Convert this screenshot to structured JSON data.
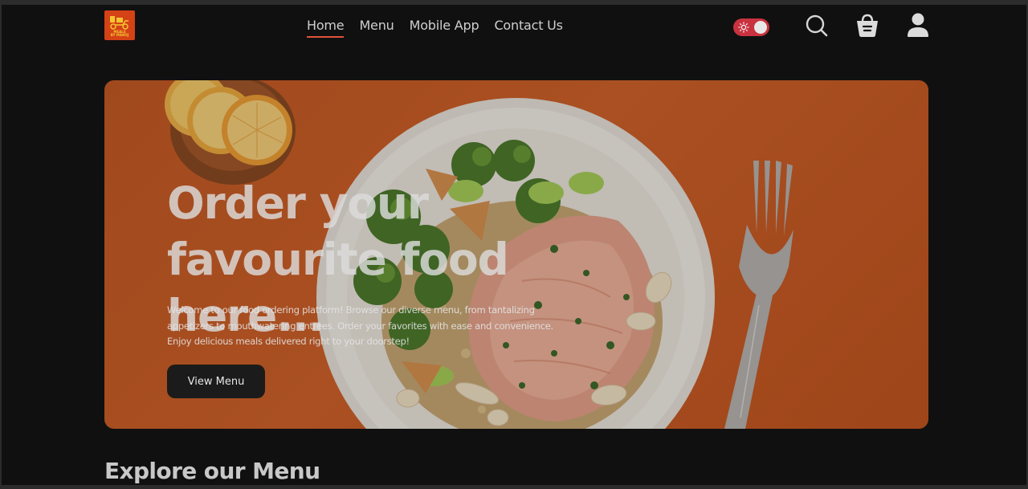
{
  "brand": {
    "logo_text": [
      "MEALS",
      "BY MANOJ"
    ]
  },
  "nav": {
    "items": [
      {
        "label": "Home",
        "active": true
      },
      {
        "label": "Menu",
        "active": false
      },
      {
        "label": "Mobile App",
        "active": false
      },
      {
        "label": "Contact Us",
        "active": false
      }
    ]
  },
  "header_icons": {
    "theme_toggle": "sun-icon",
    "search": "search-icon",
    "cart": "basket-icon",
    "profile": "user-icon"
  },
  "hero": {
    "title_line1": "Order your",
    "title_line2": "favourite food here...",
    "description_lines": [
      "Welcome to our food ordering platform! Browse our diverse menu, from tantalizing",
      "appetizers to mouthwatering entrees. Order your favorites with ease and convenience.",
      "Enjoy delicious meals delivered right to your doorstep!"
    ],
    "button_label": "View Menu"
  },
  "section": {
    "title": "Explore our Menu"
  },
  "colors": {
    "background": "#101010",
    "accent": "#e0533a",
    "toggle": "#c9323f",
    "hero_orange": "#cc5f27"
  }
}
